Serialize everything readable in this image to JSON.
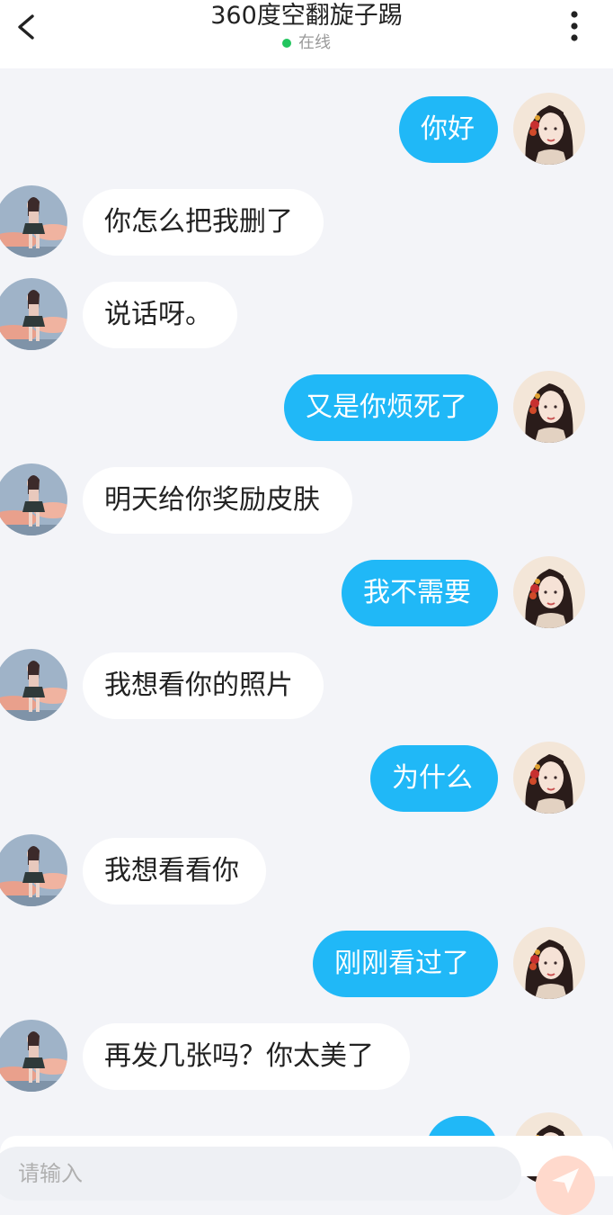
{
  "header": {
    "title": "360度空翻旋子踢",
    "status": "在线",
    "status_color": "#22c55e",
    "back_icon": "chevron-left-icon",
    "more_icon": "vertical-dots-icon"
  },
  "messages": [
    {
      "from": "me",
      "text": "你好"
    },
    {
      "from": "them",
      "text": "你怎么把我删了"
    },
    {
      "from": "them",
      "text": "说话呀。"
    },
    {
      "from": "me",
      "text": "又是你烦死了"
    },
    {
      "from": "them",
      "text": "明天给你奖励皮肤"
    },
    {
      "from": "me",
      "text": "我不需要"
    },
    {
      "from": "them",
      "text": "我想看你的照片"
    },
    {
      "from": "me",
      "text": "为什么"
    },
    {
      "from": "them",
      "text": "我想看看你"
    },
    {
      "from": "me",
      "text": "刚刚看过了"
    },
    {
      "from": "them",
      "text": "再发几张吗？你太美了"
    },
    {
      "from": "me",
      "text": ""
    }
  ],
  "composer": {
    "placeholder": "请输入",
    "send_icon": "paper-plane-icon",
    "accent_color": "#20b8f7"
  }
}
